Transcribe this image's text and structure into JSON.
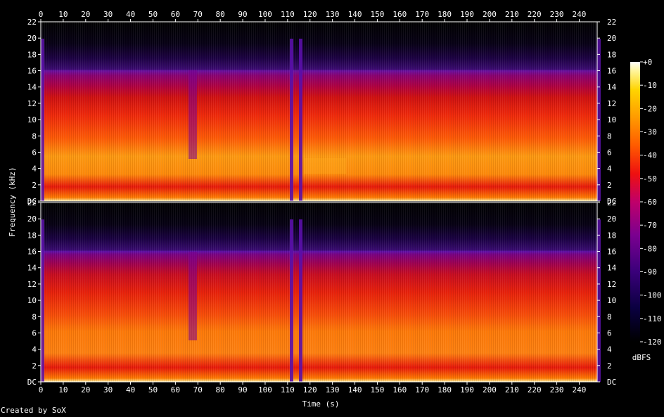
{
  "chart_data": {
    "type": "heatmap",
    "title": "",
    "xlabel": "Time (s)",
    "ylabel": "Frequency (kHz)",
    "xlim": [
      0,
      248
    ],
    "ylim": [
      0,
      22
    ],
    "x_ticks": [
      "0",
      "10",
      "20",
      "30",
      "40",
      "50",
      "60",
      "70",
      "80",
      "90",
      "100",
      "110",
      "120",
      "130",
      "140",
      "150",
      "160",
      "170",
      "180",
      "190",
      "200",
      "210",
      "220",
      "230",
      "240"
    ],
    "y_ticks": [
      "DC",
      "2",
      "4",
      "6",
      "8",
      "10",
      "12",
      "14",
      "16",
      "18",
      "20",
      "22"
    ],
    "channels": [
      "upper",
      "lower"
    ],
    "colorbar": {
      "label": "dBFS",
      "range": [
        -120,
        0
      ],
      "ticks": [
        "+0",
        "-10",
        "-20",
        "-30",
        "-40",
        "-50",
        "-60",
        "-70",
        "-80",
        "-90",
        "-100",
        "-110",
        "-120"
      ]
    },
    "description_features": {
      "spectral_cutoff_khz": 16,
      "quiet_sections_s": [
        [
          66,
          70
        ],
        [
          111,
          113
        ],
        [
          114,
          116
        ]
      ]
    }
  },
  "footer": {
    "creator": "Created by SoX"
  },
  "colors": {
    "background": "#000000",
    "text": "#ffffff",
    "axis": "#ffffff"
  }
}
